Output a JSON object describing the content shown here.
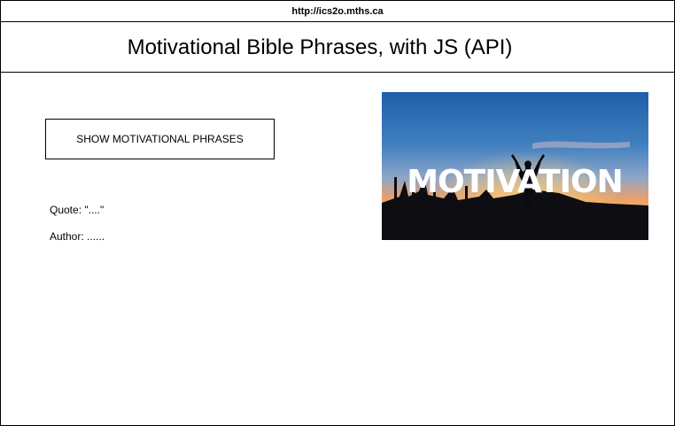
{
  "browser": {
    "url": "http://ics2o.mths.ca"
  },
  "header": {
    "title": "Motivational Bible Phrases, with JS (API)"
  },
  "main": {
    "button_label": "SHOW MOTIVATIONAL PHRASES",
    "quote_label": "Quote:",
    "quote_value": "\"....\"",
    "author_label": "Author:",
    "author_value": "......"
  },
  "hero": {
    "overlay_text": "MOTIVATION"
  }
}
